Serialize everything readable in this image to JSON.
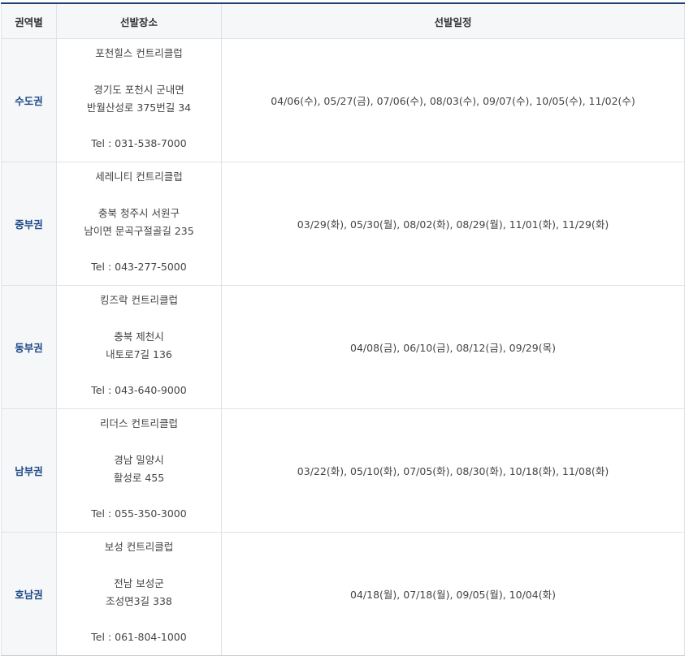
{
  "headers": {
    "region": "권역별",
    "venue": "선발장소",
    "schedule": "선발일정"
  },
  "rows": [
    {
      "region": "수도권",
      "venue_name": "포천힐스 컨트리클럽",
      "address_line1": "경기도 포천시 군내면",
      "address_line2": "반월산성로 375번길 34",
      "tel": "Tel : 031-538-7000",
      "schedule": "04/06(수), 05/27(금), 07/06(수), 08/03(수), 09/07(수), 10/05(수), 11/02(수)"
    },
    {
      "region": "중부권",
      "venue_name": "세레니티 컨트리클럽",
      "address_line1": "충북 청주시 서원구",
      "address_line2": "남이면 문곡구절골길 235",
      "tel": "Tel : 043-277-5000",
      "schedule": "03/29(화), 05/30(월), 08/02(화), 08/29(월), 11/01(화), 11/29(화)"
    },
    {
      "region": "동부권",
      "venue_name": "킹즈락 컨트리클럽",
      "address_line1": "충북 제천시",
      "address_line2": "내토로7길 136",
      "tel": "Tel : 043-640-9000",
      "schedule": "04/08(금), 06/10(금), 08/12(금), 09/29(목)"
    },
    {
      "region": "남부권",
      "venue_name": "리더스 컨트리클럽",
      "address_line1": "경남 밀양시",
      "address_line2": "활성로 455",
      "tel": "Tel : 055-350-3000",
      "schedule": "03/22(화), 05/10(화), 07/05(화), 08/30(화), 10/18(화), 11/08(화)"
    },
    {
      "region": "호남권",
      "venue_name": "보성 컨트리클럽",
      "address_line1": "전남 보성군",
      "address_line2": "조성면3길 338",
      "tel": "Tel : 061-804-1000",
      "schedule": "04/18(월), 07/18(월), 09/05(월), 10/04(화)"
    }
  ]
}
